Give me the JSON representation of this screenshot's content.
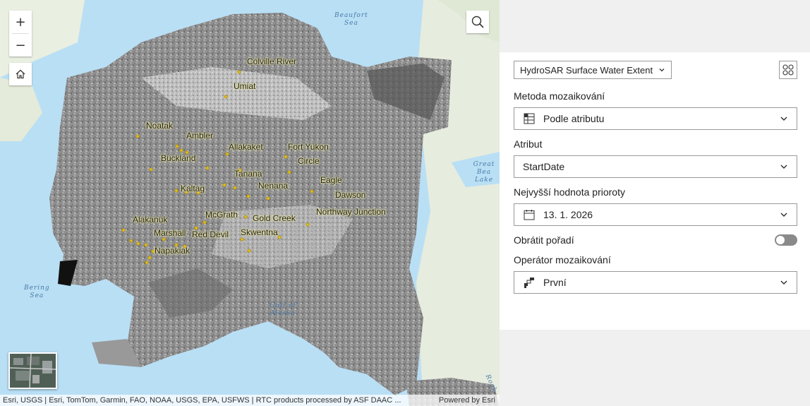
{
  "map": {
    "water_labels": [
      {
        "name": "beaufort-sea-label",
        "text": "Beaufort\nSea"
      },
      {
        "name": "bering-sea-label",
        "text": "Bering\nSea"
      },
      {
        "name": "gulf-of-alaska-label",
        "text": "Gulf of\nAlaska"
      },
      {
        "name": "great-bear-lake-label",
        "text": "Great Bea\nLake"
      },
      {
        "name": "rock-label",
        "text": "Rock"
      }
    ],
    "places": [
      {
        "text": "Colville River"
      },
      {
        "text": "Umiat"
      },
      {
        "text": "Noatak"
      },
      {
        "text": "Ambler"
      },
      {
        "text": "Buckland"
      },
      {
        "text": "Allakaket"
      },
      {
        "text": "Fort Yukon"
      },
      {
        "text": "Circle"
      },
      {
        "text": "Tanana"
      },
      {
        "text": "Eagle"
      },
      {
        "text": "Kaltag"
      },
      {
        "text": "Nenana"
      },
      {
        "text": "Dawson"
      },
      {
        "text": "McGrath"
      },
      {
        "text": "Northway Junction"
      },
      {
        "text": "Alakanuk"
      },
      {
        "text": "Gold Creek"
      },
      {
        "text": "Marshall"
      },
      {
        "text": "Red Devil"
      },
      {
        "text": "Skwentna"
      },
      {
        "text": "Napakiak"
      }
    ],
    "zoom_in": "+",
    "zoom_out": "−",
    "attribution": "Esri, USGS | Esri, TomTom, Garmin, FAO, NOAA, USGS, EPA, USFWS | RTC products processed by ASF DAAC ...",
    "powered_by": "Powered by Esri",
    "icons": {
      "search": "search-icon",
      "home": "home-icon"
    }
  },
  "panel": {
    "layer_select": "HydroSAR Surface Water Extent",
    "mosaic_method_label": "Metoda mozaikování",
    "mosaic_method_value": "Podle atributu",
    "attribute_label": "Atribut",
    "attribute_value": "StartDate",
    "priority_label": "Nejvyšší hodnota prioroty",
    "priority_value": "13. 1. 2026",
    "reverse_label": "Obrátit pořadí",
    "reverse_on": false,
    "operator_label": "Operátor mozaikování",
    "operator_value": "První"
  }
}
